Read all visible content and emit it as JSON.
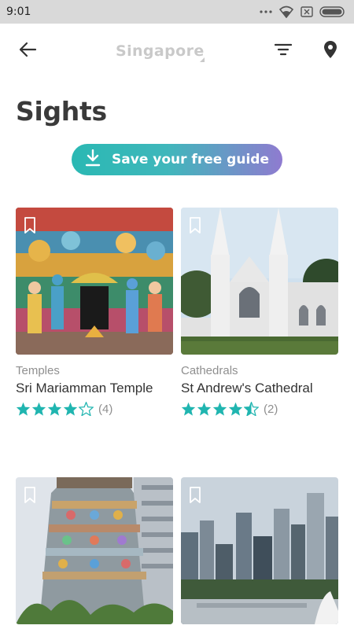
{
  "status_bar": {
    "time": "9:01"
  },
  "header": {
    "title": "Singapore"
  },
  "page": {
    "title": "Sights"
  },
  "guide_button": {
    "label": "Save your free guide"
  },
  "colors": {
    "teal": "#2ab8b3",
    "purple": "#8f7bd0",
    "star": "#20b5b0"
  },
  "cards": [
    {
      "category": "Temples",
      "name": "Sri Mariamman Temple",
      "rating": 4,
      "rating_count": "(4)"
    },
    {
      "category": "Cathedrals",
      "name": "St Andrew's Cathedral",
      "rating": 4.5,
      "rating_count": "(2)"
    },
    {
      "category": "",
      "name": "",
      "rating": null,
      "rating_count": ""
    },
    {
      "category": "",
      "name": "",
      "rating": null,
      "rating_count": ""
    }
  ]
}
